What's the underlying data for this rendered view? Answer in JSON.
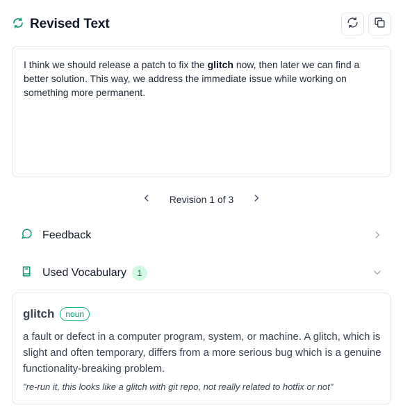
{
  "header": {
    "title": "Revised Text",
    "title_icon": "refresh-icon",
    "refresh_button_icon": "refresh-icon",
    "copy_button_icon": "copy-icon"
  },
  "revised_text": {
    "before": "I think we should release a patch to fix the ",
    "highlight": "glitch",
    "after": " now, then later we can find a better solution. This way, we address the immediate issue while working on something more permanent."
  },
  "pagination": {
    "label": "Revision 1 of 3",
    "prev_icon": "chevron-left-icon",
    "next_icon": "chevron-right-icon"
  },
  "feedback": {
    "label": "Feedback",
    "icon": "chat-bubble-icon",
    "chevron": "chevron-right-icon"
  },
  "vocabulary": {
    "label": "Used Vocabulary",
    "count": "1",
    "icon": "book-icon",
    "chevron": "chevron-down-icon",
    "items": [
      {
        "word": "glitch",
        "part_of_speech": "noun",
        "definition": "a fault or defect in a computer program, system, or machine. A glitch, which is slight and often temporary, differs from a more serious bug which is a genuine functionality-breaking problem.",
        "example": "\"re-run it, this looks like a glitch with git repo, not really related to hotfix or not\""
      }
    ]
  },
  "colors": {
    "accent": "#059669",
    "badge_bg": "#d1fae5",
    "border": "#e5e7eb"
  }
}
